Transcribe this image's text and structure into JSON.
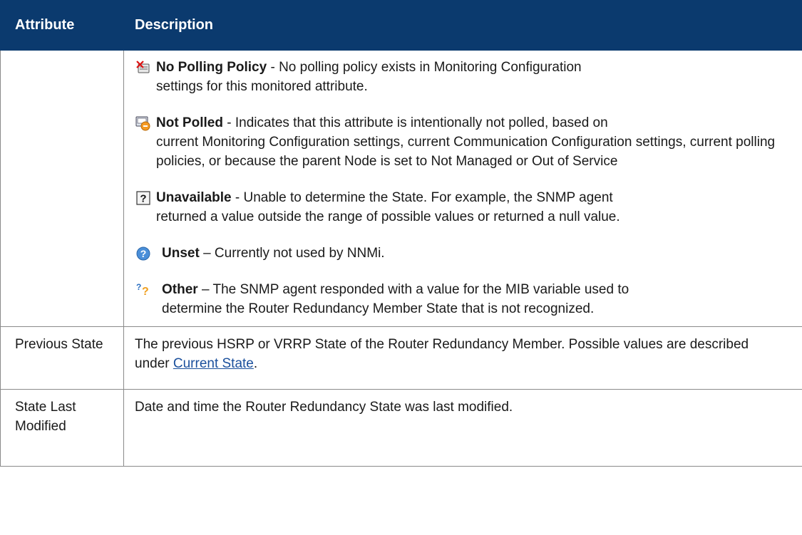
{
  "header": {
    "attribute": "Attribute",
    "description": "Description"
  },
  "states": [
    {
      "icon": "no-polling-policy-icon",
      "name": "No Polling Policy",
      "sep": " - ",
      "line1": "No polling policy exists in Monitoring Configuration",
      "rest": "settings for this monitored attribute."
    },
    {
      "icon": "not-polled-icon",
      "name": "Not Polled",
      "sep": " - ",
      "line1": "Indicates that this attribute is intentionally not polled, based on",
      "rest": "current Monitoring Configuration settings, current Communication Configuration settings, current polling policies, or because the parent Node is set to Not Managed or Out of Service"
    },
    {
      "icon": "unavailable-icon",
      "name": "Unavailable",
      "sep": " - ",
      "line1": "Unable to determine the State. For example, the SNMP agent",
      "rest": "returned a value outside the range of possible values or returned a null value."
    },
    {
      "icon": "unset-icon",
      "name": "Unset",
      "sep": " – ",
      "line1": "Currently not used by NNMi.",
      "rest": ""
    },
    {
      "icon": "other-icon",
      "name": "Other",
      "sep": " – ",
      "line1": "The SNMP agent responded with a value for the MIB variable used to",
      "rest": "determine the Router Redundancy Member State that is not recognized."
    }
  ],
  "rows": {
    "previous_state": {
      "attribute": "Previous State",
      "description_prefix": "The previous HSRP or VRRP State of the Router Redundancy Member. Possible values are described under ",
      "link_text": "Current State",
      "description_suffix": "."
    },
    "state_last_modified": {
      "attribute": "State Last Modified",
      "description": "Date and time the Router Redundancy State was last modified."
    }
  },
  "colors": {
    "header_bg": "#0b3a6e",
    "link": "#1a4f9c",
    "border": "#8a8a8a"
  }
}
